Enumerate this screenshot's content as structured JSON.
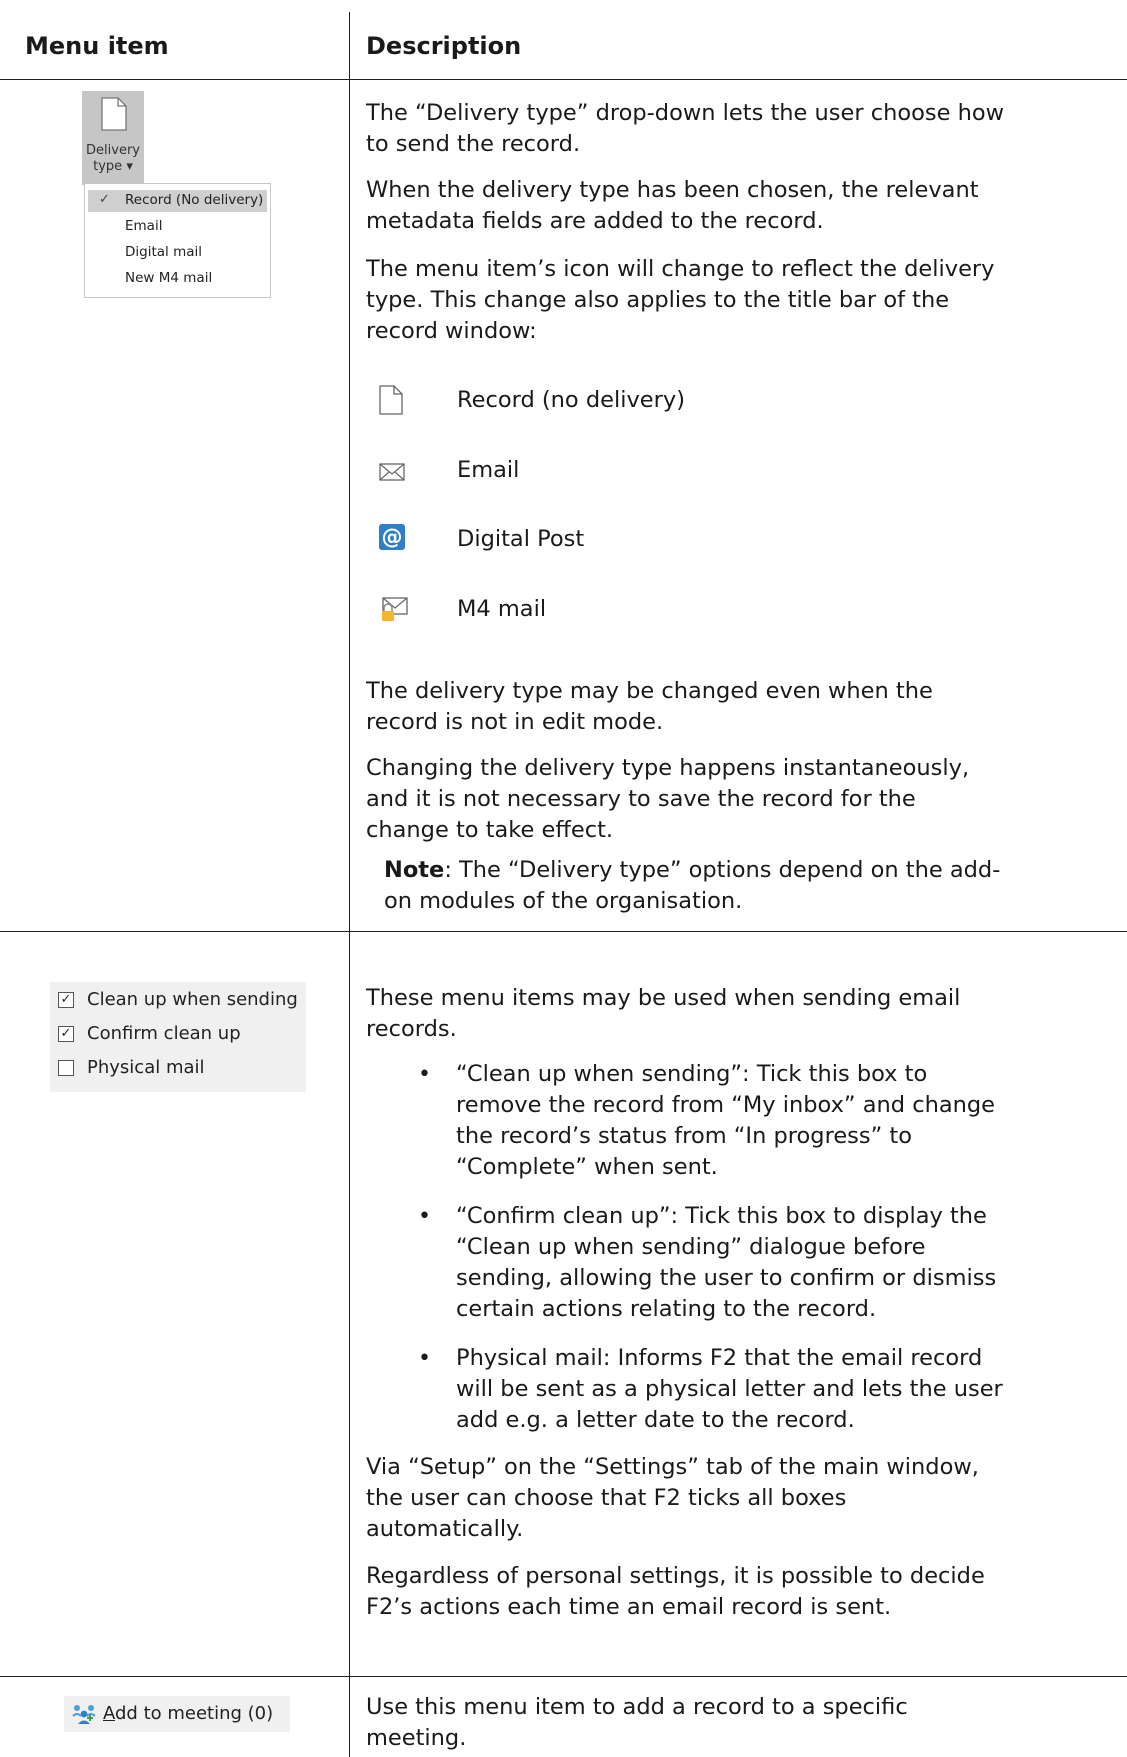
{
  "table": {
    "header_left": "Menu item",
    "header_right": "Description"
  },
  "delivery": {
    "button_label_line1": "Delivery",
    "button_label_line2": "type ▾",
    "menu": [
      {
        "label": "Record (No delivery)",
        "selected": true
      },
      {
        "label": "Email",
        "selected": false
      },
      {
        "label": "Digital mail",
        "selected": false
      },
      {
        "label": "New M4 mail",
        "selected": false
      }
    ],
    "checkmark": "✓",
    "paragraphs": [
      [
        "The “Delivery type” drop-down lets the user choose how",
        "to send the record."
      ],
      [
        "When the delivery type has been chosen, the relevant",
        "metadata fields are added to the record."
      ],
      [
        "The menu item’s icon will change to reflect the delivery",
        "type. This change also applies to the title bar of the",
        "record window:"
      ]
    ],
    "icon_list": [
      {
        "icon": "document-icon",
        "label": "Record (no delivery)"
      },
      {
        "icon": "envelope-icon",
        "label": "Email"
      },
      {
        "icon": "at-sign-icon",
        "label": "Digital Post"
      },
      {
        "icon": "locked-envelope-icon",
        "label": "M4 mail"
      }
    ],
    "paragraphs_after": [
      [
        "The delivery type may be changed even when the",
        "record is not in edit mode."
      ],
      [
        "Changing the delivery type happens instantaneously,",
        "and it is not necessary to save the record for the",
        "change to take effect."
      ]
    ],
    "note_label": "Note",
    "note_text_1": ": The “Delivery type” options depend on the add-",
    "note_text_2": "on modules of the organisation."
  },
  "sending": {
    "checkboxes": [
      {
        "label": "Clean up when sending",
        "checked": true
      },
      {
        "label": "Confirm clean up",
        "checked": true
      },
      {
        "label": "Physical mail",
        "checked": false
      }
    ],
    "checkmark": "✓",
    "intro": [
      "These menu items may be used when sending email",
      "records."
    ],
    "bullet": "•",
    "bullets": [
      [
        "“Clean up when sending”: Tick this box to",
        "remove the record from “My inbox” and change",
        "the record’s status from “In progress” to",
        "“Complete” when sent."
      ],
      [
        "“Confirm clean up”: Tick this box to display the",
        "“Clean up when sending” dialogue before",
        "sending, allowing the user to confirm or dismiss",
        "certain actions relating to the record."
      ],
      [
        "Physical mail: Informs F2 that the email record",
        "will be sent as a physical letter and lets the user",
        "add e.g. a letter date to the record."
      ]
    ],
    "para_setup": [
      "Via “Setup” on the “Settings” tab of the main window,",
      "the user can choose that F2 ticks all boxes",
      "automatically."
    ],
    "para_regardless": [
      "Regardless of personal settings, it is possible to decide",
      "F2’s actions each time an email record is sent."
    ]
  },
  "meeting": {
    "button_label_accel": "A",
    "button_label_rest": "dd to meeting (0)",
    "desc": [
      "Use this menu item to add a record to a specific",
      "meeting."
    ]
  }
}
